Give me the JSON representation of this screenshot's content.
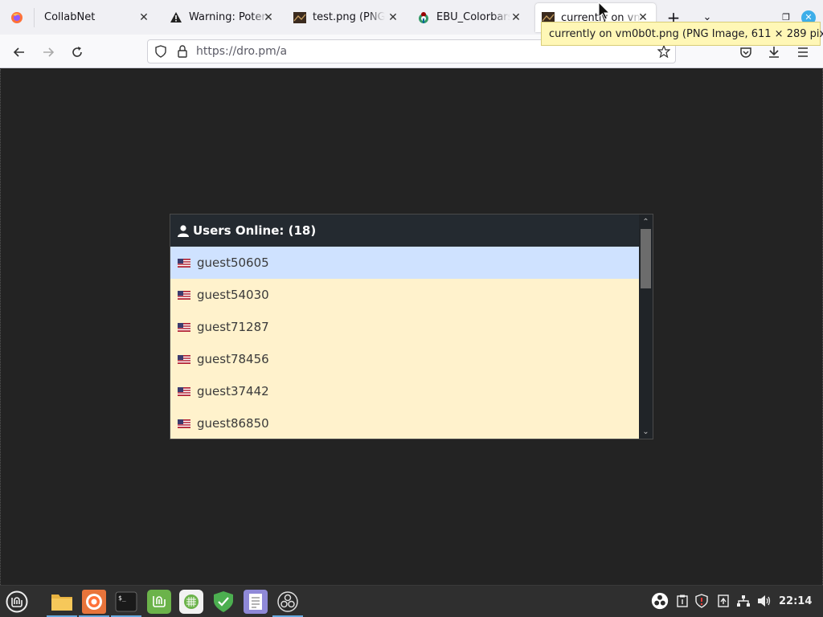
{
  "browser": {
    "tabs": [
      {
        "title": "",
        "favicon": "firefox-icon"
      },
      {
        "title": "CollabNet",
        "favicon": "none"
      },
      {
        "title": "Warning: Potential Security Risk",
        "favicon": "warning-icon"
      },
      {
        "title": "test.png (PNG Image)",
        "favicon": "image-icon"
      },
      {
        "title": "EBU_Colorbars.svg",
        "favicon": "wikimedia-icon"
      },
      {
        "title": "currently on vm0b0t.png",
        "favicon": "image-icon",
        "active": true
      }
    ],
    "tooltip": "currently on vm0b0t.png (PNG Image, 611 × 289 pixels)",
    "url": "https://dro.pm/a"
  },
  "users_panel": {
    "title": "Users Online: (18)",
    "users": [
      {
        "name": "guest50605",
        "flag": "us-flag",
        "selected": true
      },
      {
        "name": "guest54030",
        "flag": "us-flag"
      },
      {
        "name": "guest71287",
        "flag": "us-flag"
      },
      {
        "name": "guest78456",
        "flag": "us-flag"
      },
      {
        "name": "guest37442",
        "flag": "us-flag"
      },
      {
        "name": "guest86850",
        "flag": "us-flag"
      }
    ]
  },
  "taskbar": {
    "apps": [
      "mint-menu-icon",
      "files-icon",
      "firefox-icon",
      "terminal-icon",
      "mint-update-icon",
      "network-icon",
      "shield-icon",
      "text-editor-icon",
      "obs-icon"
    ],
    "clock": "22:14"
  },
  "colors": {
    "accent": "#65a9e0",
    "selected_row": "#cfe2ff",
    "row_bg": "#fff2cc",
    "header_bg": "#242a30"
  }
}
